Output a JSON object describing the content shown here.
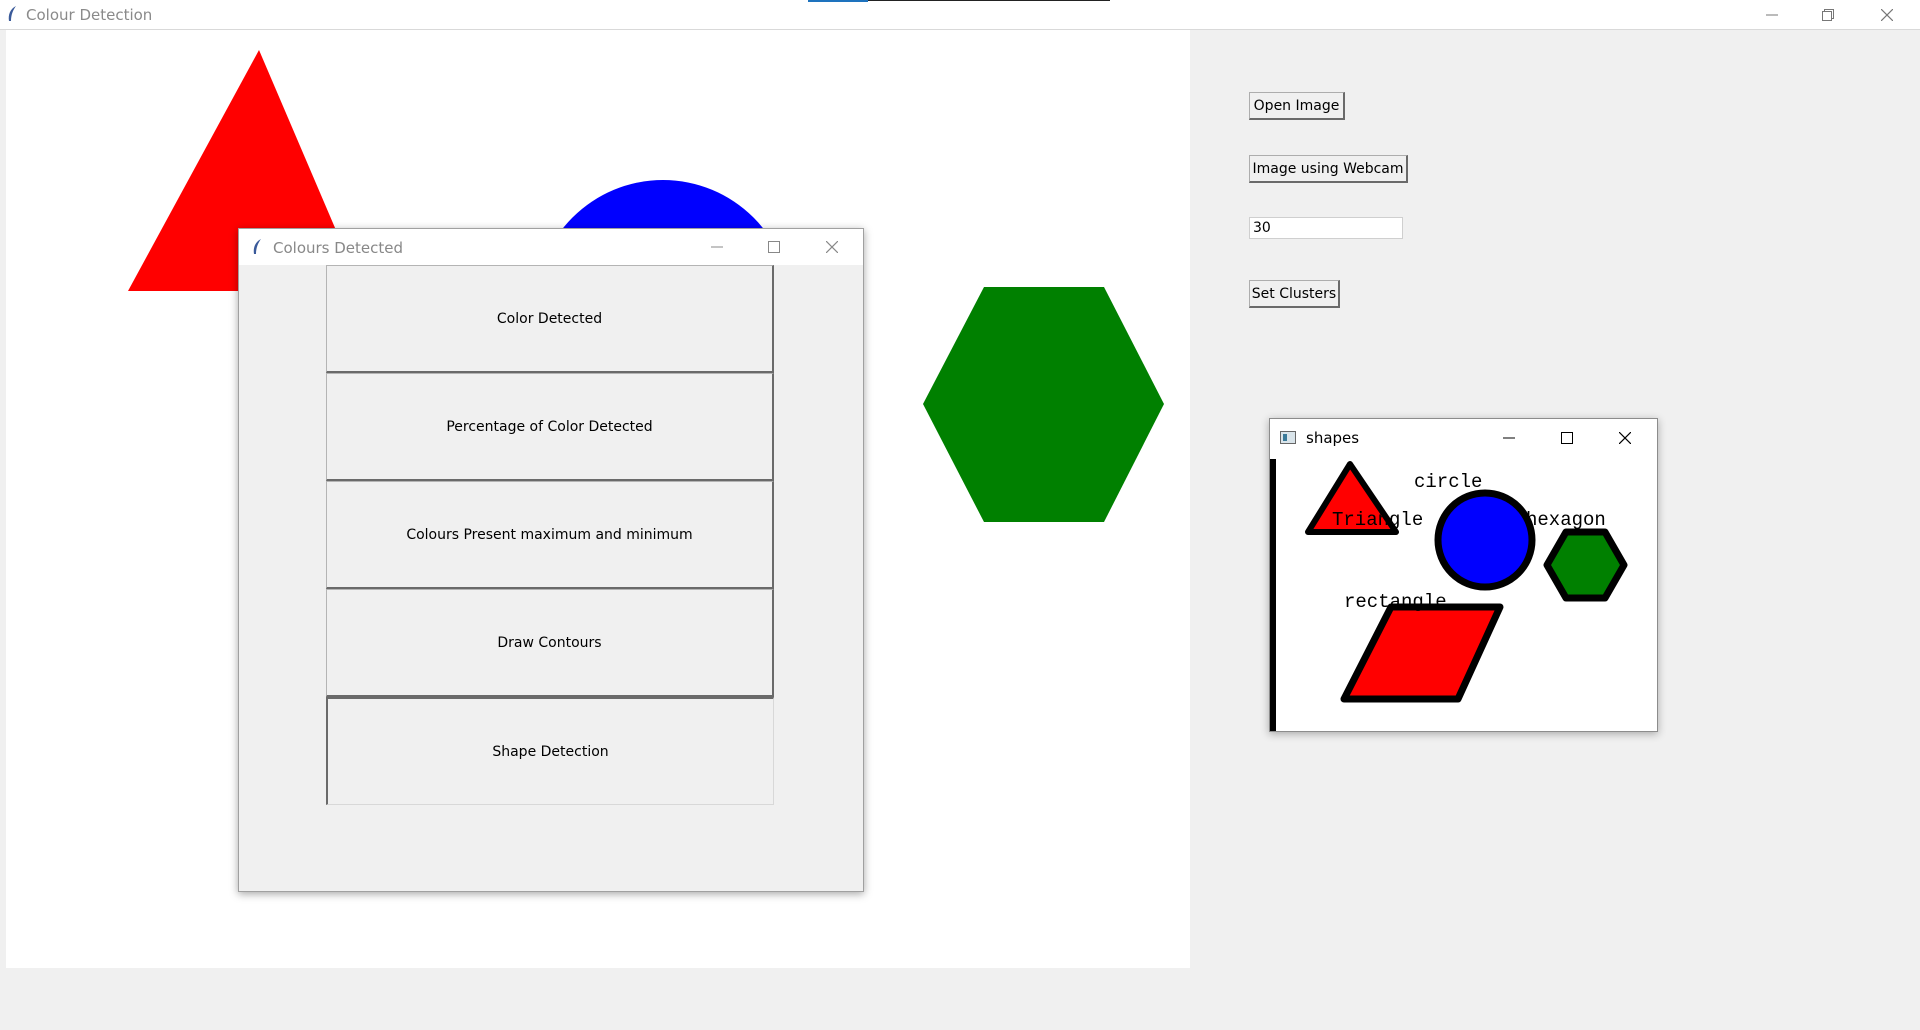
{
  "main_window": {
    "title": "Colour Detection",
    "controls": {
      "open_image": "Open Image",
      "webcam": "Image using Webcam",
      "clusters_value": "30",
      "set_clusters": "Set Clusters"
    }
  },
  "canvas": {
    "shapes": [
      {
        "name": "triangle",
        "color": "#ff0000"
      },
      {
        "name": "circle",
        "color": "#0000ff"
      },
      {
        "name": "hexagon",
        "color": "#008000"
      }
    ]
  },
  "dialog": {
    "title": "Colours Detected",
    "buttons": [
      "Color Detected",
      "Percentage of Color Detected",
      "Colours Present maximum and minimum",
      "Draw Contours",
      "Shape Detection"
    ]
  },
  "shapes_window": {
    "title": "shapes",
    "labels": {
      "triangle": "Triangle",
      "circle": "circle",
      "hexagon": "hexagon",
      "rectangle": "rectangle"
    }
  }
}
